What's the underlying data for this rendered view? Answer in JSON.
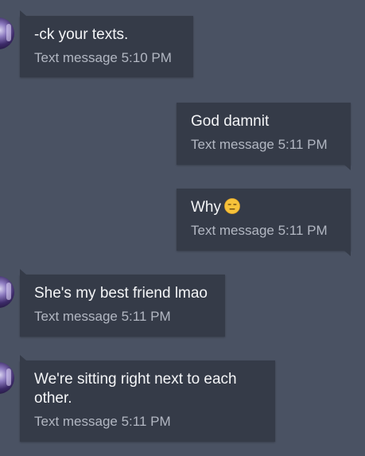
{
  "messages": [
    {
      "direction": "incoming",
      "text": "-ck your texts.",
      "meta": "Text message 5:10 PM"
    },
    {
      "direction": "outgoing",
      "text": "God damnit",
      "meta": "Text message 5:11 PM"
    },
    {
      "direction": "outgoing",
      "text": "Why",
      "emoji": "expressionless-face-icon",
      "meta": "Text message 5:11 PM"
    },
    {
      "direction": "incoming",
      "text": "She's my best friend lmao",
      "meta": "Text message 5:11 PM"
    },
    {
      "direction": "incoming",
      "text": "We're sitting right next to each other.",
      "meta": "Text message 5:11 PM"
    }
  ],
  "colors": {
    "background": "#4a5263",
    "bubble": "#353b48",
    "message_text": "#f4f5f7",
    "meta_text": "#b2b7c2"
  }
}
